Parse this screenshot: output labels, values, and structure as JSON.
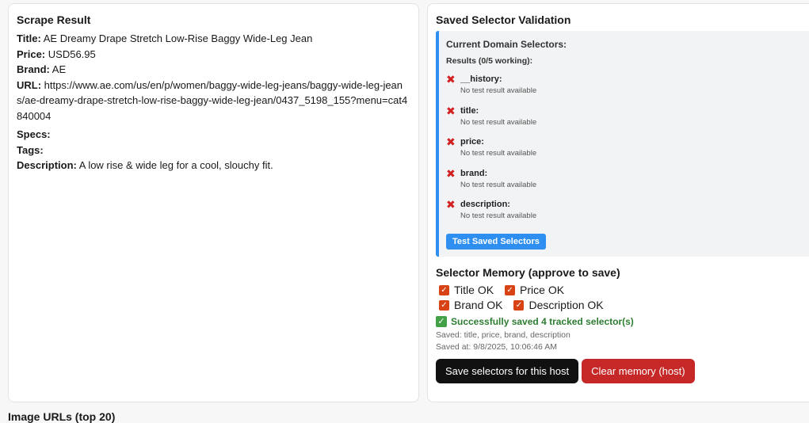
{
  "scrape": {
    "title": "Scrape Result",
    "fields": {
      "title_label": "Title:",
      "title_value": "AE Dreamy Drape Stretch Low-Rise Baggy Wide-Leg Jean",
      "price_label": "Price:",
      "price_value": "USD56.95",
      "brand_label": "Brand:",
      "brand_value": "AE",
      "url_label": "URL:",
      "url_value": "https://www.ae.com/us/en/p/women/baggy-wide-leg-jeans/baggy-wide-leg-jeans/ae-dreamy-drape-stretch-low-rise-baggy-wide-leg-jean/0437_5198_155?menu=cat4840004",
      "specs_label": "Specs:",
      "tags_label": "Tags:",
      "description_label": "Description:",
      "description_value": "A low rise & wide leg for a cool, slouchy fit."
    }
  },
  "validation": {
    "title": "Saved Selector Validation",
    "domain_label": "Current Domain Selectors:",
    "results_label": "Results (0/5 working):",
    "selectors": [
      {
        "name": "__history:",
        "status": "No test result available"
      },
      {
        "name": "title:",
        "status": "No test result available"
      },
      {
        "name": "price:",
        "status": "No test result available"
      },
      {
        "name": "brand:",
        "status": "No test result available"
      },
      {
        "name": "description:",
        "status": "No test result available"
      }
    ],
    "test_button": "Test Saved Selectors"
  },
  "memory": {
    "title": "Selector Memory (approve to save)",
    "checks": [
      {
        "label": "Title OK",
        "checked": true
      },
      {
        "label": "Price OK",
        "checked": true
      },
      {
        "label": "Brand OK",
        "checked": true
      },
      {
        "label": "Description OK",
        "checked": true
      }
    ],
    "success_text": "Successfully saved 4 tracked selector(s)",
    "saved_fields": "Saved: title, price, brand, description",
    "saved_at": "Saved at: 9/8/2025, 10:06:46 AM",
    "save_button": "Save selectors for this host",
    "clear_button": "Clear memory (host)"
  },
  "images": {
    "title": "Image URLs (top 20)"
  },
  "colors": {
    "accent_blue": "#2e8ff0",
    "error_red": "#d21f1f",
    "checkbox_orange": "#d84315",
    "success_green": "#2e7d32",
    "dark_button": "#111111",
    "danger_button": "#c62828"
  },
  "icons": {
    "fail": "x-mark-icon",
    "checkbox": "checkbox-checked-icon",
    "success": "check-square-icon"
  }
}
